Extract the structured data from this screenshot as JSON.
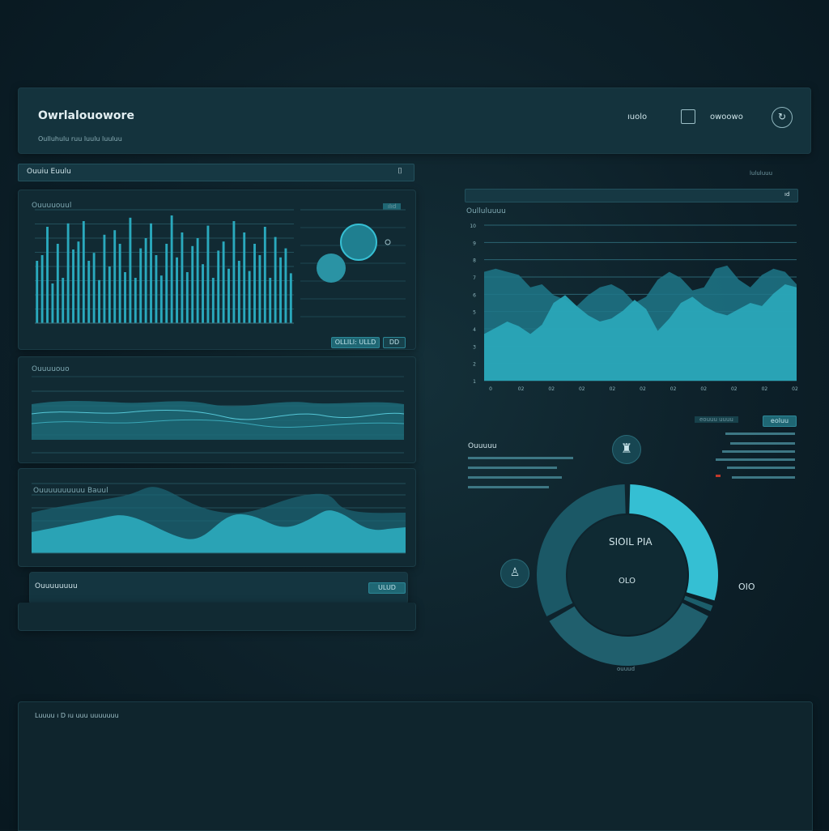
{
  "header": {
    "title": "Owrlalouowore",
    "subtitle": "Oulluhulu ruu luulu luuluu",
    "nav_item_1": "ıuolo",
    "nav_item_2": "owoowo"
  },
  "left": {
    "section_bar_label": "Ouuiu Euulu",
    "bar_panel_title": "Ouuuuouul",
    "bar_panel_badge": "ılıd",
    "bar_panel_button": "OLLILI: ULLD",
    "bar_panel_button_2": "DD",
    "wave_panel_title": "Ouuuuouo",
    "area_panel_title": "Ouuuuuuuuuu Bauul",
    "footer_panel_title": "Ouuuuuuuu",
    "footer_panel_button": "ULUD"
  },
  "right": {
    "top_label": "lululuuu",
    "area_chart_title": "Oulluluuuu",
    "area_strip_badge": "ıd",
    "legend_button": "eoluu",
    "legend_caption": "eouuu uuuu",
    "list_title": "Ouuuuu",
    "donut_center_title": "SIOIL PIA",
    "donut_center_value": "OLO",
    "donut_side_value": "OIO",
    "donut_caption": "ouuud"
  },
  "footer": {
    "text": "Luuuu ı D ıu uuu uuuuuuu"
  },
  "colors": {
    "accent": "#2bb6c9",
    "accent_dark": "#1d7b8a",
    "panel": "#112a33"
  },
  "chart_data": [
    {
      "type": "bar",
      "values": [
        55,
        60,
        85,
        35,
        70,
        40,
        88,
        65,
        72,
        90,
        55,
        62,
        38,
        78,
        50,
        82,
        70,
        45,
        93,
        40,
        66,
        75,
        88,
        60,
        42,
        70,
        95,
        58,
        80,
        45,
        68,
        75,
        52,
        86,
        40,
        64,
        72,
        48,
        90,
        55,
        80,
        46,
        70,
        60,
        85,
        40,
        76,
        58,
        66,
        44
      ]
    },
    {
      "type": "area",
      "series": [
        {
          "values": [
            70,
            72,
            70,
            68,
            60,
            62,
            55,
            52,
            48,
            55,
            60,
            62,
            58,
            50,
            54,
            65,
            70,
            66,
            58,
            60,
            72,
            74,
            65,
            60,
            68,
            72,
            70,
            62
          ]
        },
        {
          "values": [
            30,
            34,
            38,
            35,
            30,
            36,
            50,
            55,
            48,
            42,
            38,
            40,
            45,
            52,
            46,
            32,
            40,
            50,
            54,
            48,
            44,
            42,
            46,
            50,
            48,
            56,
            62,
            60
          ]
        }
      ],
      "y_ticks": [
        "10",
        "9",
        "8",
        "7",
        "6",
        "5",
        "4",
        "3",
        "2",
        "1"
      ],
      "x_ticks": [
        "0",
        "02",
        "02",
        "02",
        "02",
        "02",
        "02",
        "02",
        "02",
        "02",
        "02"
      ]
    },
    {
      "type": "pie",
      "values": [
        30,
        2,
        35,
        33
      ]
    }
  ]
}
